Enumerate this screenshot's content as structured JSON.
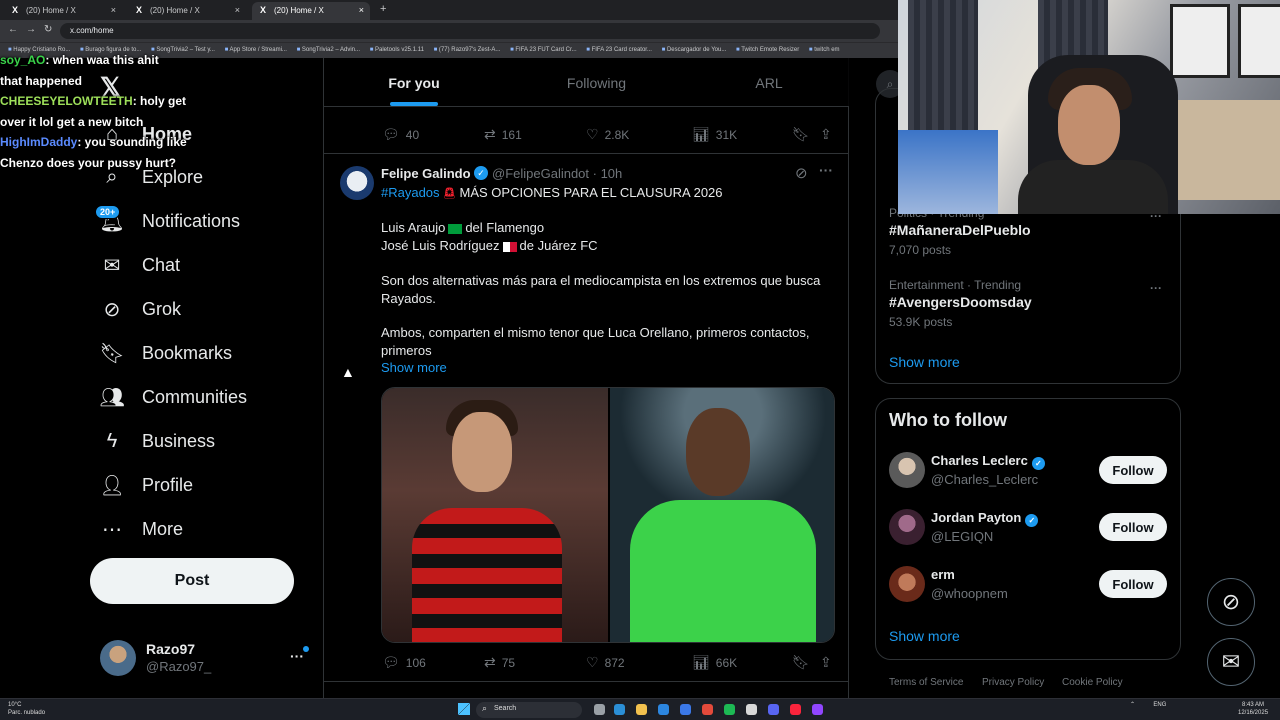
{
  "browser": {
    "tabs": [
      {
        "label": "(20) Home / X"
      },
      {
        "label": "(20) Home / X"
      },
      {
        "label": "(20) Home / X"
      }
    ],
    "url": "x.com/home",
    "bookmarks": [
      "Happy Cristiano Ro...",
      "Burago figura de to...",
      "SongTrivia2 – Test y...",
      "App Store / Streami...",
      "SongTrivia2 – Advin...",
      "Paletools v25.1.11",
      "(77) Razo97's Zest-A...",
      "FIFA 23 FUT Card Cr...",
      "FIFA 23 Card creator...",
      "Descargador de You...",
      "Twitch Emote Resizer",
      "twitch em"
    ]
  },
  "chat": [
    {
      "user": "soy_AO",
      "text": ": when waa this ahit"
    },
    {
      "user": "",
      "text": "that happened"
    },
    {
      "user": "CHEESEYELOWTEETH",
      "text": ": holy get"
    },
    {
      "user": "",
      "text": "over it lol get a new bitch"
    },
    {
      "user": "HighImDaddy",
      "text": ": you sounding like"
    },
    {
      "user": "",
      "text": "Chenzo does your pussy hurt?"
    }
  ],
  "sidebar": {
    "items": [
      {
        "label": "Home",
        "icon": "home-icon"
      },
      {
        "label": "Explore",
        "icon": "search-icon"
      },
      {
        "label": "Notifications",
        "icon": "bell-icon"
      },
      {
        "label": "Chat",
        "icon": "mail-icon"
      },
      {
        "label": "Grok",
        "icon": "grok-icon"
      },
      {
        "label": "Bookmarks",
        "icon": "bookmark-icon"
      },
      {
        "label": "Communities",
        "icon": "communities-icon"
      },
      {
        "label": "Business",
        "icon": "lightning-icon"
      },
      {
        "label": "Profile",
        "icon": "person-icon"
      },
      {
        "label": "More",
        "icon": "more-circle-icon"
      }
    ],
    "notifications_badge": "20+",
    "post_label": "Post",
    "user": {
      "name": "Razo97",
      "handle": "@Razo97_"
    }
  },
  "feed": {
    "tabs": [
      {
        "label": "For you"
      },
      {
        "label": "Following"
      },
      {
        "label": "ARL"
      }
    ],
    "prev_tweet_stats": {
      "replies": "40",
      "reposts": "161",
      "likes": "2.8K",
      "views": "31K"
    },
    "tweet": {
      "name": "Felipe Galindo",
      "handle": "@FelipeGalindot · 10h",
      "hashtag": "#Rayados",
      "headline": "MÁS OPCIONES PARA EL CLAUSURA 2026",
      "line1a": "Luis Araujo",
      "line1b": "del Flamengo",
      "line2a": "José Luis Rodríguez",
      "line2b": "de Juárez FC",
      "para1": "Son dos alternativas más para el mediocampista en los extremos que busca Rayados.",
      "para2": "Ambos, comparten el mismo tenor que Luca Orellano, primeros contactos, primeros",
      "show_more": "Show more",
      "stats": {
        "replies": "106",
        "reposts": "75",
        "likes": "872",
        "views": "66K"
      }
    }
  },
  "right": {
    "trends": [
      {
        "meta": "Politics · Trending",
        "name": "#MañaneraDelPueblo",
        "posts": "7,070 posts"
      },
      {
        "meta": "Entertainment · Trending",
        "name": "#AvengersDoomsday",
        "posts": "53.9K posts"
      }
    ],
    "trends_show_more": "Show more",
    "who_to_follow_title": "Who to follow",
    "follow": [
      {
        "name": "Charles Leclerc",
        "handle": "@Charles_Leclerc",
        "verified": true,
        "button": "Follow"
      },
      {
        "name": "Jordan Payton",
        "handle": "@LEGIQN",
        "verified": true,
        "button": "Follow"
      },
      {
        "name": "erm",
        "handle": "@whoopnem",
        "verified": false,
        "button": "Follow"
      }
    ],
    "follow_show_more": "Show more",
    "footer": [
      "Terms of Service",
      "Privacy Policy",
      "Cookie Policy"
    ]
  },
  "taskbar": {
    "weather_temp": "10°C",
    "weather_desc": "Parc. nublado",
    "search_label": "Search",
    "lang": "ENG",
    "time": "8:43 AM",
    "date": "12/16/2025"
  }
}
